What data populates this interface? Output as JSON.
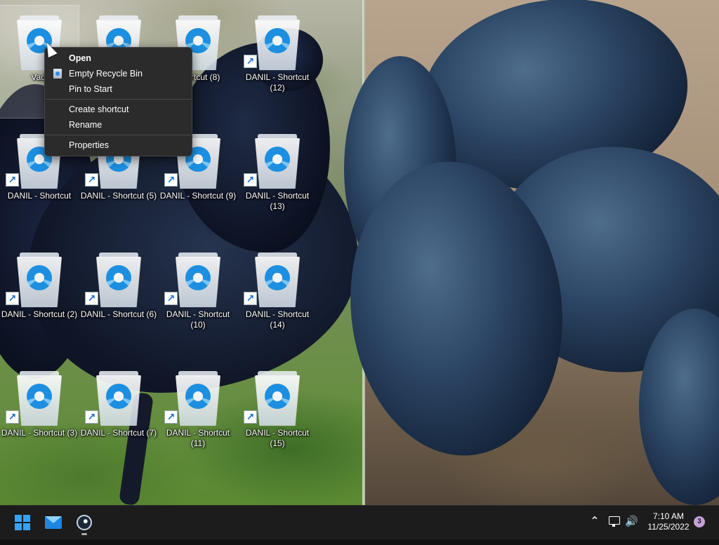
{
  "context_menu": {
    "open": "Open",
    "empty_recycle_bin": "Empty Recycle Bin",
    "pin_to_start": "Pin to Start",
    "create_shortcut": "Create shortcut",
    "rename": "Rename",
    "properties": "Properties"
  },
  "desktop": {
    "icons": [
      {
        "label": "Vadi",
        "selected": true,
        "shortcut": false
      },
      {
        "label": "",
        "shortcut": true
      },
      {
        "label": "Shortcut (8)",
        "shortcut": true
      },
      {
        "label": "DANIL - Shortcut (12)",
        "shortcut": true
      },
      {
        "label": "DANIL - Shortcut",
        "shortcut": true
      },
      {
        "label": "DANIL - Shortcut (5)",
        "shortcut": true
      },
      {
        "label": "DANIL - Shortcut (9)",
        "shortcut": true
      },
      {
        "label": "DANIL - Shortcut (13)",
        "shortcut": true
      },
      {
        "label": "DANIL - Shortcut (2)",
        "shortcut": true
      },
      {
        "label": "DANIL - Shortcut (6)",
        "shortcut": true
      },
      {
        "label": "DANIL - Shortcut (10)",
        "shortcut": true
      },
      {
        "label": "DANIL - Shortcut (14)",
        "shortcut": true
      },
      {
        "label": "DANIL - Shortcut (3)",
        "shortcut": true
      },
      {
        "label": "DANIL - Shortcut (7)",
        "shortcut": true
      },
      {
        "label": "DANIL - Shortcut (11)",
        "shortcut": true
      },
      {
        "label": "DANIL - Shortcut (15)",
        "shortcut": true
      }
    ]
  },
  "taskbar": {
    "time": "7:10 AM",
    "date": "11/25/2022",
    "notification_count": "3",
    "pinned": [
      "windows-start-icon",
      "mail-icon",
      "steam-icon"
    ]
  },
  "colors": {
    "taskbar_bg": "#1c1c1c",
    "menu_bg": "#2b2b2b",
    "accent": "#1d86e0"
  }
}
